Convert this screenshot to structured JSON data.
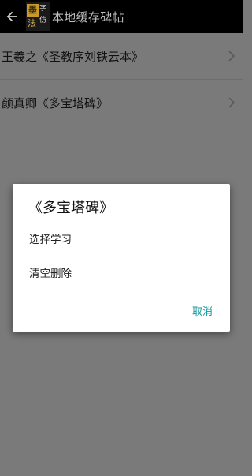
{
  "appbar": {
    "title": "本地缓存碑帖",
    "back_icon": "arrow-left-icon",
    "logo": {
      "glyph_1": "墨",
      "glyph_2": "字",
      "glyph_3": "法",
      "glyph_4": "仿"
    }
  },
  "list": {
    "items": [
      {
        "label": "王羲之《圣教序刘铁云本》",
        "icon": "chevron-right-icon"
      },
      {
        "label": "颜真卿《多宝塔碑》",
        "icon": "chevron-right-icon"
      }
    ]
  },
  "dialog": {
    "title": "《多宝塔碑》",
    "options": [
      {
        "label": "选择学习"
      },
      {
        "label": "清空删除"
      }
    ],
    "cancel_label": "取消"
  },
  "colors": {
    "appbar_bg": "#000000",
    "scrim_bg": "#7a7a7a",
    "accent": "#139aa0",
    "dialog_bg": "#ffffff"
  }
}
